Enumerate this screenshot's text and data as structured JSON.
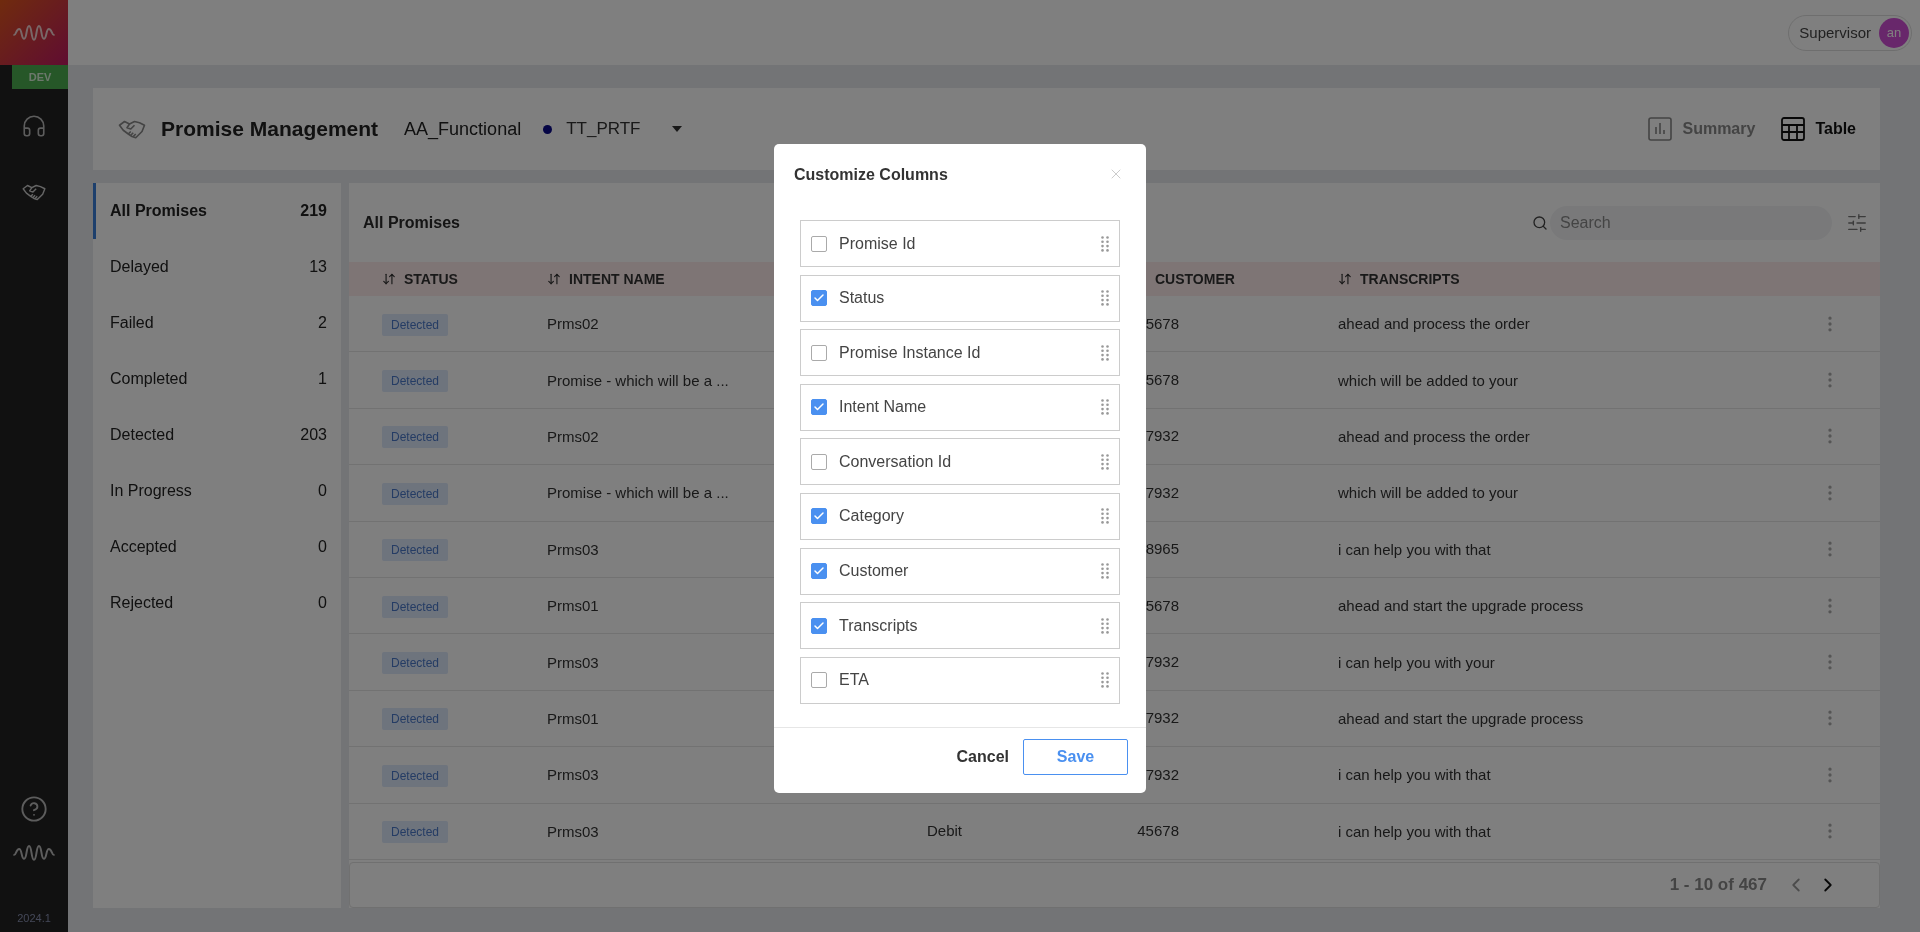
{
  "app": {
    "env_badge": "DEV",
    "version": "2024.1"
  },
  "user": {
    "role": "Supervisor",
    "initials": "an"
  },
  "header": {
    "title": "Promise Management",
    "project": "AA_Functional",
    "environment": "TT_PRTF",
    "views": [
      {
        "kind": "summary",
        "label": "Summary",
        "selected": false
      },
      {
        "kind": "table",
        "label": "Table",
        "selected": true
      }
    ]
  },
  "filters": [
    {
      "label": "All Promises",
      "count": "219",
      "selected": true
    },
    {
      "label": "Delayed",
      "count": "13",
      "selected": false
    },
    {
      "label": "Failed",
      "count": "2",
      "selected": false
    },
    {
      "label": "Completed",
      "count": "1",
      "selected": false
    },
    {
      "label": "Detected",
      "count": "203",
      "selected": false
    },
    {
      "label": "In Progress",
      "count": "0",
      "selected": false
    },
    {
      "label": "Accepted",
      "count": "0",
      "selected": false
    },
    {
      "label": "Rejected",
      "count": "0",
      "selected": false
    }
  ],
  "table": {
    "title": "All Promises",
    "search": {
      "placeholder": "Search"
    },
    "columns": [
      {
        "kind": "status",
        "label": "STATUS",
        "sortable": true
      },
      {
        "kind": "intent",
        "label": "INTENT NAME",
        "sortable": true
      },
      {
        "kind": "customer",
        "label": "CUSTOMER"
      },
      {
        "kind": "transcripts",
        "label": "TRANSCRIPTS",
        "sortable": true
      }
    ],
    "rows": [
      {
        "status": "Detected",
        "intent": "Prms02",
        "customer": "5678",
        "transcript": "ahead and process the order"
      },
      {
        "status": "Detected",
        "intent": "Promise - which will be a ...",
        "customer": "5678",
        "transcript": "which will be added to your"
      },
      {
        "status": "Detected",
        "intent": "Prms02",
        "customer": "7932",
        "transcript": "ahead and process the order"
      },
      {
        "status": "Detected",
        "intent": "Promise - which will be a ...",
        "customer": "7932",
        "transcript": "which will be added to your"
      },
      {
        "status": "Detected",
        "intent": "Prms03",
        "customer": "8965",
        "transcript": "i can help you with that"
      },
      {
        "status": "Detected",
        "intent": "Prms01",
        "customer": "5678",
        "transcript": "ahead and start the upgrade process"
      },
      {
        "status": "Detected",
        "intent": "Prms03",
        "customer": "7932",
        "transcript": "i can help you with your"
      },
      {
        "status": "Detected",
        "intent": "Prms01",
        "customer": "7932",
        "transcript": "ahead and start the upgrade process"
      },
      {
        "status": "Detected",
        "intent": "Prms03",
        "customer": "7932",
        "transcript": "i can help you with that"
      },
      {
        "status": "Detected",
        "intent": "Prms03",
        "category": "Debit",
        "customer": "45678",
        "transcript": "i can help you with that"
      }
    ],
    "pagination": {
      "label": "1 - 10 of 467",
      "prev_enabled": false,
      "next_enabled": true
    }
  },
  "modal": {
    "title": "Customize Columns",
    "items": [
      {
        "label": "Promise Id",
        "checked": false
      },
      {
        "label": "Status",
        "checked": true
      },
      {
        "label": "Promise Instance Id",
        "checked": false
      },
      {
        "label": "Intent Name",
        "checked": true
      },
      {
        "label": "Conversation Id",
        "checked": false
      },
      {
        "label": "Category",
        "checked": true
      },
      {
        "label": "Customer",
        "checked": true
      },
      {
        "label": "Transcripts",
        "checked": true
      },
      {
        "label": "ETA",
        "checked": false
      }
    ],
    "actions": [
      {
        "kind": "cancel",
        "label": "Cancel"
      },
      {
        "kind": "save",
        "label": "Save"
      }
    ]
  }
}
